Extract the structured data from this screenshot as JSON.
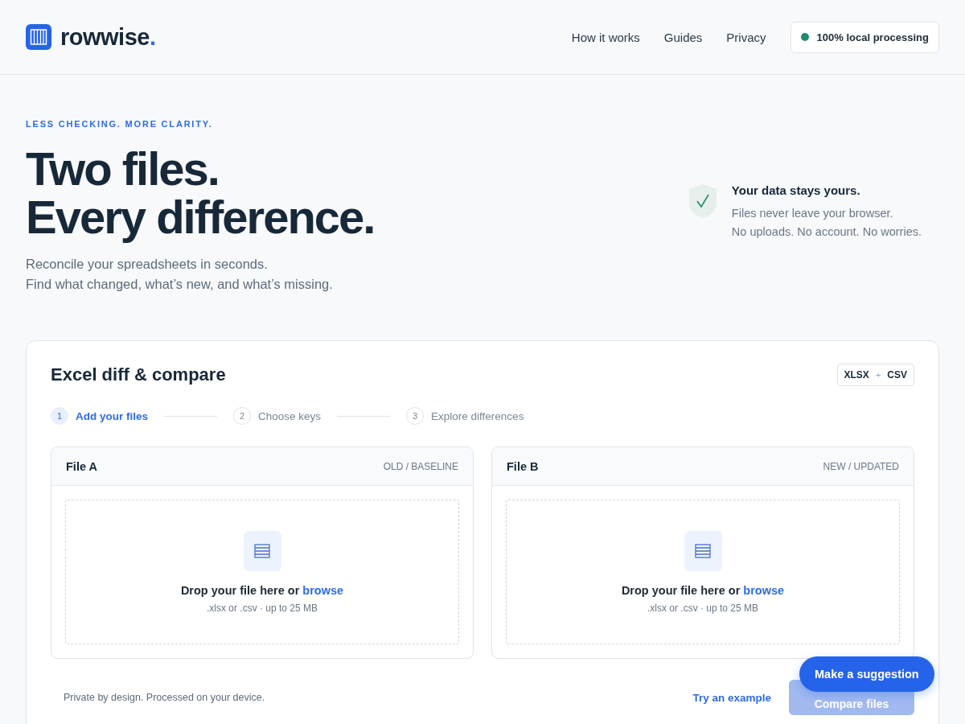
{
  "brand": {
    "name": "rowwise",
    "dot": "."
  },
  "nav": {
    "links": [
      "How it works",
      "Guides",
      "Privacy"
    ],
    "badge": {
      "label": "100% local processing",
      "color": "#1f8a70"
    }
  },
  "hero": {
    "eyebrow": "LESS CHECKING. MORE CLARITY.",
    "title_lines": [
      "Two files.",
      "Every difference."
    ],
    "subtitle_lines": [
      "Reconcile your spreadsheets in seconds.",
      "Find what changed, what’s new, and what’s missing."
    ],
    "note": {
      "title": "Your data stays yours.",
      "lines": [
        "Files never leave your browser.",
        "No uploads. No account. No worries."
      ]
    }
  },
  "card": {
    "title": "Excel diff & compare",
    "formats": [
      "XLSX",
      "+",
      "CSV"
    ],
    "steps": [
      {
        "number": "1",
        "label": "Add your files",
        "selected": true
      },
      {
        "number": "2",
        "label": "Choose keys",
        "selected": false
      },
      {
        "number": "3",
        "label": "Explore differences",
        "selected": false
      }
    ],
    "files": [
      {
        "name": "File A",
        "tag": "OLD / BASELINE",
        "prompt": "Drop your file here or ",
        "link": "browse",
        "hint": ".xlsx or .csv · up to 25 MB"
      },
      {
        "name": "File B",
        "tag": "NEW / UPDATED",
        "prompt": "Drop your file here or ",
        "link": "browse",
        "hint": ".xlsx or .csv · up to 25 MB"
      }
    ],
    "footer_note": "Private by design. Processed on your device.",
    "example_link": "Try an example",
    "compare_button": {
      "label": "Compare files",
      "disabled": true
    }
  },
  "floating_button": "Make a suggestion"
}
